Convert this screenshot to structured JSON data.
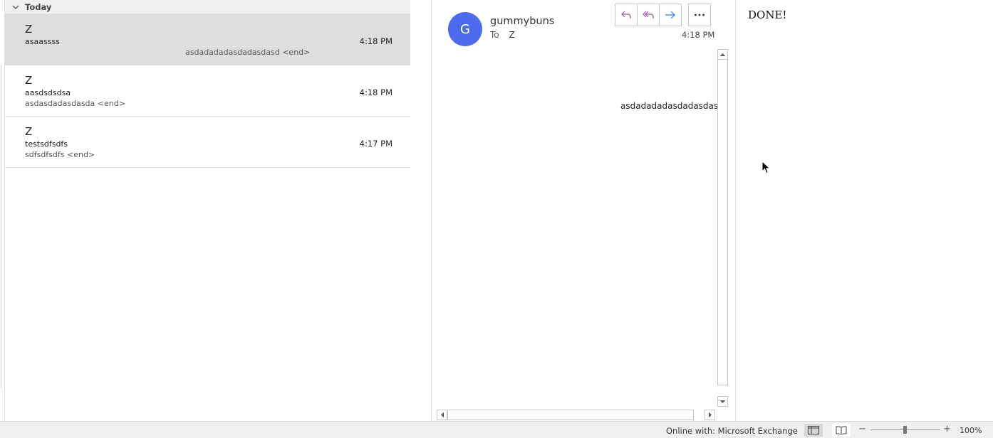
{
  "message_list": {
    "group_label": "Today",
    "items": [
      {
        "sender": "Z",
        "subject": "asaassss",
        "time": "4:18 PM",
        "preview": "asdadadadasdadasdasd <end>",
        "selected": true
      },
      {
        "sender": "Z",
        "subject": "aasdsdsdsa",
        "time": "4:18 PM",
        "preview": "asdasdadasdasda <end>",
        "selected": false
      },
      {
        "sender": "Z",
        "subject": "testsdfsdfs",
        "time": "4:17 PM",
        "preview": "sdfsdfsdfs <end>",
        "selected": false
      }
    ]
  },
  "reading_pane": {
    "avatar_letter": "G",
    "from": "gummybuns",
    "to_label": "To",
    "to": "Z",
    "time": "4:18 PM",
    "body": "asdadadadasdadasdasd",
    "accent_color": "#4f6bed",
    "actions": [
      "reply-icon",
      "reply-all-icon",
      "forward-icon",
      "more-icon"
    ]
  },
  "right_pane": {
    "text": "DONE!"
  },
  "status_bar": {
    "connection": "Online with: Microsoft Exchange",
    "zoom": "100%",
    "zoom_minus": "−",
    "zoom_plus": "+"
  }
}
